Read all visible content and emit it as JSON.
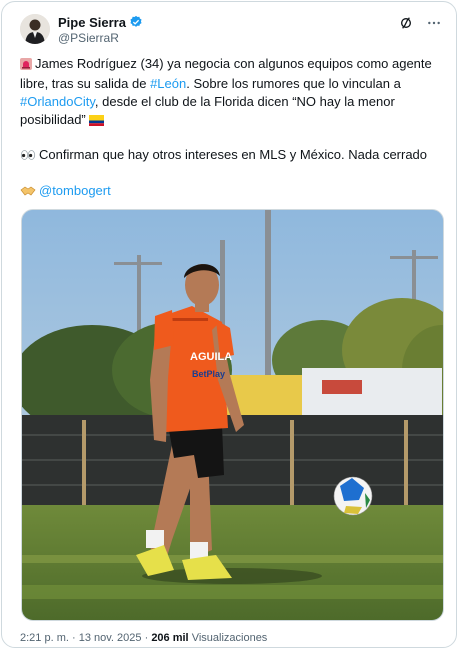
{
  "author": {
    "name": "Pipe Sierra",
    "handle": "@PSierraR",
    "verified": true
  },
  "tweet": {
    "para1": {
      "text_a": "James Rodríguez (34) ya negocia con algunos equipos como agente libre, tras su salida de ",
      "hashtag_leon": "#León",
      "text_b": ". Sobre los rumores que lo vinculan a ",
      "hashtag_orlando": "#OrlandoCity",
      "text_c": ", desde el club de la Florida dicen “NO hay la menor posibilidad”"
    },
    "para2": "Confirman que hay otros intereses en MLS y México. Nada cerrado",
    "mention": "@tombogert"
  },
  "photo": {
    "jersey_sponsor": "AGUILA",
    "jersey_sponsor2": "BetPlay"
  },
  "footer": {
    "time": "2:21 p. m.",
    "separator": "·",
    "date": "13 nov. 2025",
    "views_count": "206 mil",
    "views_label": "Visualizaciones"
  },
  "colors": {
    "link": "#1d9bf0",
    "verified": "#1d9bf0",
    "muted": "#536471"
  },
  "icons": [
    "verified-badge-icon",
    "grok-icon",
    "more-icon",
    "siren-icon",
    "flag-colombia-icon",
    "eyes-icon",
    "handshake-icon"
  ]
}
